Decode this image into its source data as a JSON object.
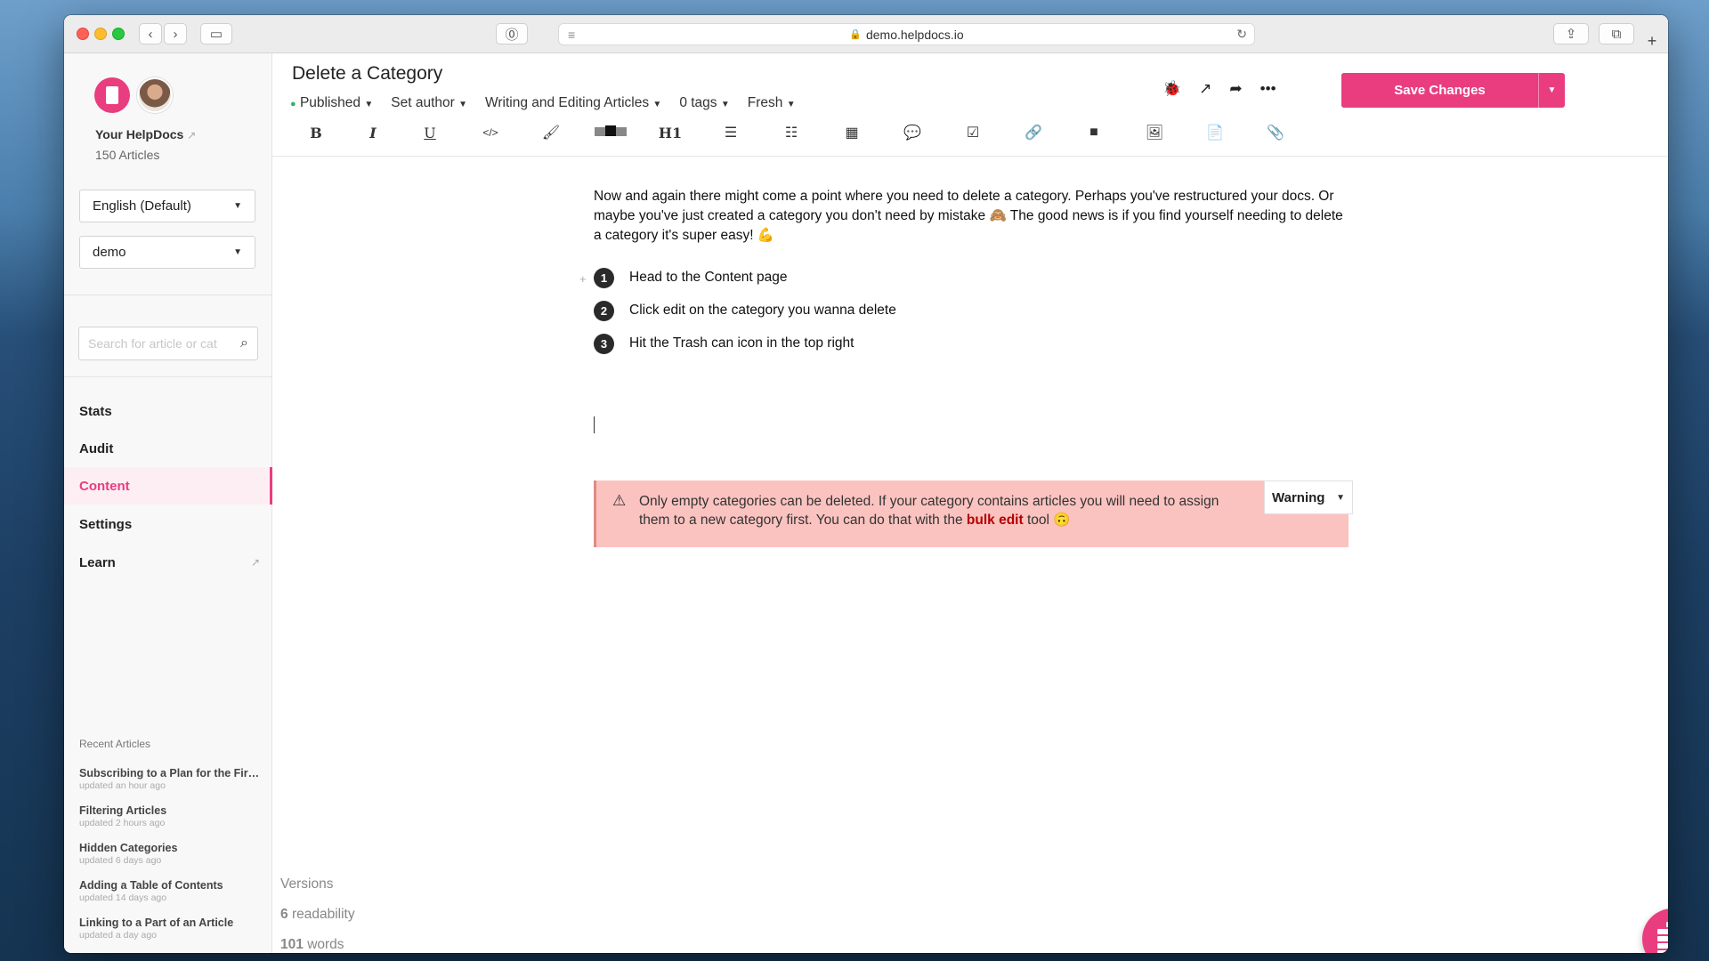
{
  "browser": {
    "url": "demo.helpdocs.io",
    "lock_icon": "lock-icon",
    "new_tab_icon": "plus-icon"
  },
  "sidebar": {
    "brand": "Your HelpDocs",
    "articles_count": "150 Articles",
    "language_select": "English (Default)",
    "workspace_select": "demo",
    "search_placeholder": "Search for article or cat",
    "nav": [
      {
        "label": "Stats"
      },
      {
        "label": "Audit"
      },
      {
        "label": "Content",
        "active": true
      },
      {
        "label": "Settings"
      },
      {
        "label": "Learn"
      }
    ],
    "recent_heading": "Recent Articles",
    "recent": [
      {
        "title": "Subscribing to a Plan for the First Time",
        "updated": "updated an hour ago"
      },
      {
        "title": "Filtering Articles",
        "updated": "updated 2 hours ago"
      },
      {
        "title": "Hidden Categories",
        "updated": "updated 6 days ago"
      },
      {
        "title": "Adding a Table of Contents",
        "updated": "updated 14 days ago"
      },
      {
        "title": "Linking to a Part of an Article",
        "updated": "updated a day ago"
      }
    ]
  },
  "editor": {
    "title": "Delete a Category",
    "status": "Published",
    "author": "Set author",
    "category": "Writing and Editing Articles",
    "tags": "0 tags",
    "freshness": "Fresh",
    "save_label": "Save Changes",
    "intro": "Now and again there might come a point where you need to delete a category. Perhaps you've restructured your docs. Or maybe you've just created a category you don't need by mistake 🙈 The good news is if you find yourself needing to delete a category it's super easy! 💪",
    "steps": [
      {
        "num": "1",
        "text": "Head to the Content page"
      },
      {
        "num": "2",
        "text": "Click edit on the category you wanna delete"
      },
      {
        "num": "3",
        "text": "Hit the Trash can icon in the top right"
      }
    ],
    "warning": {
      "before": "Only empty categories can be deleted. If your category contains articles you will need to assign them to a new category first. You can do that with the ",
      "link": "bulk edit",
      "after": " tool 🙃",
      "type": "Warning"
    },
    "stats": {
      "versions": "Versions",
      "readability_num": "6",
      "readability_label": "readability",
      "words_num": "101",
      "words_label": "words"
    }
  },
  "colors": {
    "accent": "#e93d80",
    "warning_bg": "#fbc3c0",
    "published_dot": "#2fb36a"
  }
}
